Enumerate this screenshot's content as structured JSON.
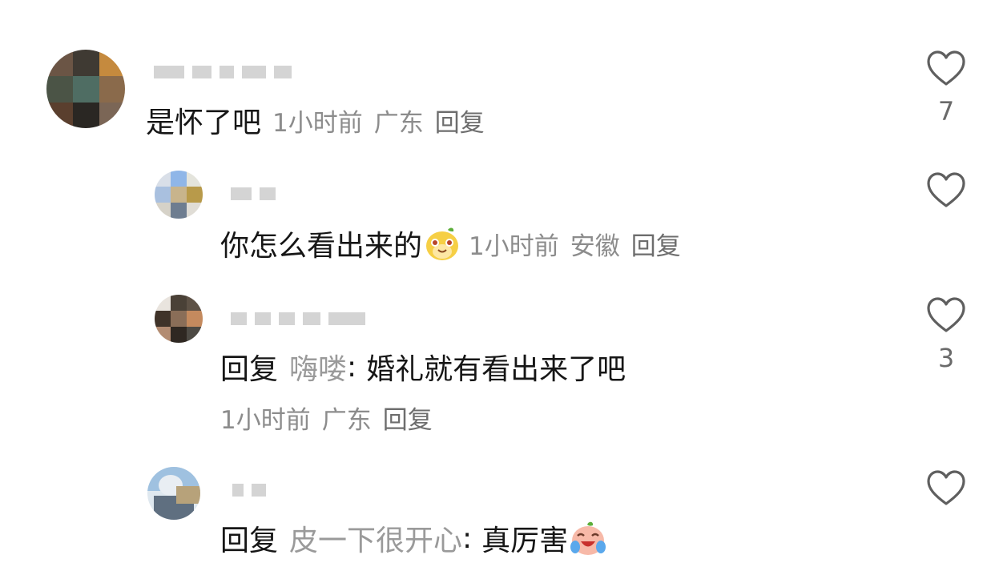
{
  "comments": [
    {
      "text": "是怀了吧",
      "time": "1小时前",
      "location": "广东",
      "reply_action": "回复",
      "likes": "7"
    },
    {
      "text": "你怎么看出来的",
      "emoji": "smiling-mole-emoji",
      "time": "1小时前",
      "location": "安徽",
      "reply_action": "回复",
      "likes": ""
    },
    {
      "reply_label": "回复",
      "reply_to": "嗨喽",
      "text": "婚礼就有看出来了吧",
      "time": "1小时前",
      "location": "广东",
      "reply_action": "回复",
      "likes": "3"
    },
    {
      "reply_label": "回复",
      "reply_to": "皮一下很开心",
      "text": "真厉害",
      "emoji": "crying-laughing-emoji",
      "likes": ""
    }
  ],
  "colors": {
    "text": "#161616",
    "meta": "#8c8c8c",
    "reply_target": "#9a9a9a",
    "heart": "#5f5f5f"
  },
  "icons": {
    "like": "heart-outline-icon"
  }
}
